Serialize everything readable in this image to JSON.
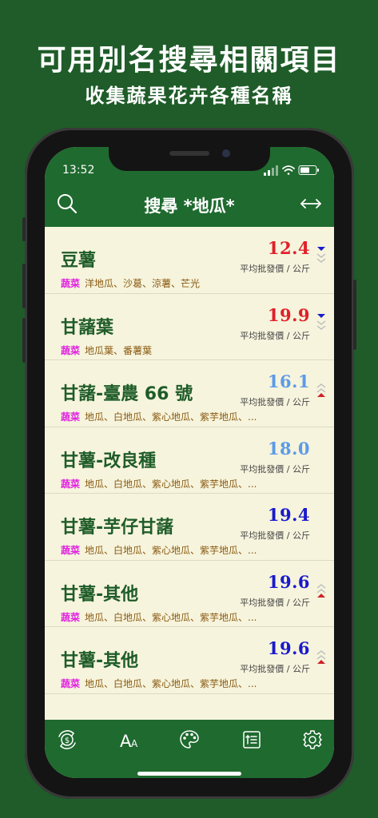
{
  "promo": {
    "headline": "可用別名搜尋相關項目",
    "subheadline": "收集蔬果花卉各種名稱"
  },
  "status": {
    "time": "13:52"
  },
  "nav": {
    "title": "搜尋 *地瓜*"
  },
  "items": [
    {
      "name": "豆薯",
      "price": "12.4",
      "price_color": "#e0202a",
      "unit": "平均批發價 / 公斤",
      "category": "蔬菜",
      "aliases": "洋地瓜、沙葛、涼薯、芒光",
      "trend": "down"
    },
    {
      "name": "甘藷葉",
      "price": "19.9",
      "price_color": "#e0202a",
      "unit": "平均批發價 / 公斤",
      "category": "蔬菜",
      "aliases": "地瓜葉、番薯葉",
      "trend": "down"
    },
    {
      "name": "甘藷-臺農 66 號",
      "price": "16.1",
      "price_color": "#5b9be8",
      "unit": "平均批發價 / 公斤",
      "category": "蔬菜",
      "aliases": "地瓜、白地瓜、紫心地瓜、紫芋地瓜、...",
      "trend": "up"
    },
    {
      "name": "甘薯-改良種",
      "price": "18.0",
      "price_color": "#5b9be8",
      "unit": "平均批發價 / 公斤",
      "category": "蔬菜",
      "aliases": "地瓜、白地瓜、紫心地瓜、紫芋地瓜、...",
      "trend": "none"
    },
    {
      "name": "甘薯-芋仔甘藷",
      "price": "19.4",
      "price_color": "#1a1acc",
      "unit": "平均批發價 / 公斤",
      "category": "蔬菜",
      "aliases": "地瓜、白地瓜、紫心地瓜、紫芋地瓜、...",
      "trend": "none"
    },
    {
      "name": "甘薯-其他",
      "price": "19.6",
      "price_color": "#1a1acc",
      "unit": "平均批發價 / 公斤",
      "category": "蔬菜",
      "aliases": "地瓜、白地瓜、紫心地瓜、紫芋地瓜、...",
      "trend": "up"
    },
    {
      "name": "甘薯-其他",
      "price": "19.6",
      "price_color": "#1a1acc",
      "unit": "平均批發價 / 公斤",
      "category": "蔬菜",
      "aliases": "地瓜、白地瓜、紫心地瓜、紫芋地瓜、...",
      "trend": "up"
    }
  ],
  "tabs": [
    "price-change-icon",
    "font-size-icon",
    "palette-icon",
    "sort-list-icon",
    "settings-gear-icon"
  ]
}
